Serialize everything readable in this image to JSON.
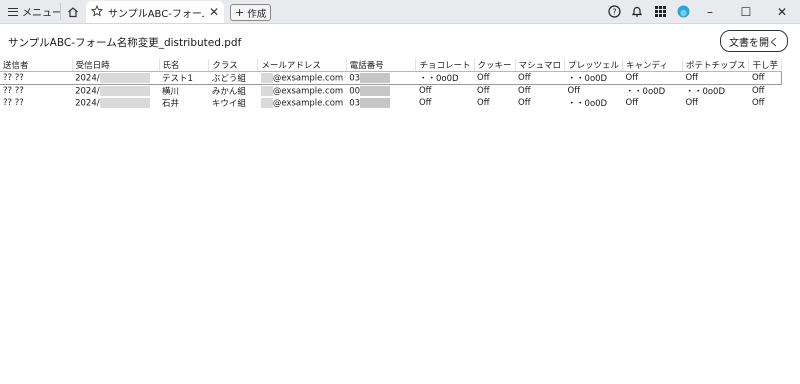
{
  "menu": {
    "label": "メニュー"
  },
  "tab": {
    "title": "サンプルABC-フォーム...",
    "close": "✕"
  },
  "new_tab": {
    "label": "作成",
    "plus": "+"
  },
  "icons": [
    "help-icon",
    "bell-icon",
    "apps-grid-icon",
    "avatar"
  ],
  "doc": {
    "filename": "サンプルABC-フォーム名称変更_distributed.pdf",
    "open_label": "文書を開く"
  },
  "table": {
    "headers": [
      "送信者",
      "受信日時",
      "氏名",
      "クラス",
      "メールアドレス",
      "電話番号",
      "チョコレート",
      "クッキー",
      "マシュマロ",
      "プレッツェル",
      "キャンディ",
      "ポテトチップス",
      "干し芋"
    ],
    "rows": [
      [
        "?? ??",
        "2024/",
        "テスト1",
        "ぶどう組",
        "@exsample.com",
        "03",
        "・・0o0D",
        "Off",
        "Off",
        "・・0o0D",
        "Off",
        "Off",
        "Off"
      ],
      [
        "?? ??",
        "2024/",
        "横川",
        "みかん組",
        "@exsample.com",
        "00",
        "Off",
        "Off",
        "Off",
        "Off",
        "・・0o0D",
        "・・0o0D",
        "Off"
      ],
      [
        "?? ??",
        "2024/",
        "石井",
        "キウイ組",
        "@exsample.com",
        "03",
        "Off",
        "Off",
        "Off",
        "・・0o0D",
        "Off",
        "Off",
        "Off"
      ]
    ]
  }
}
